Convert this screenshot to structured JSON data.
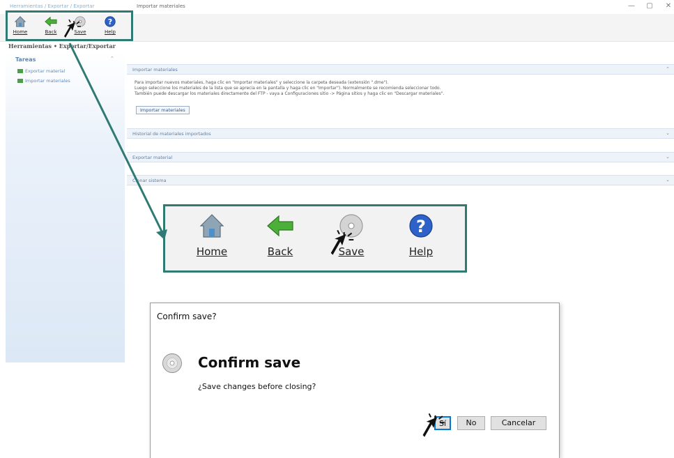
{
  "window": {
    "title_left": "Herramientas / Exportar / Exportar",
    "title": "Importar materiales",
    "minimize": "—",
    "maximize": "▢",
    "close": "✕"
  },
  "toolbar": {
    "home": "Home",
    "back": "Back",
    "save": "Save",
    "help": "Help"
  },
  "breadcrumb": "Herramientas • Exportar/Exportar",
  "sidebar": {
    "title": "Tareas",
    "collapse": "⌃",
    "tasks": [
      "Exportar material",
      "Importar materiales"
    ]
  },
  "panels": {
    "import_title": "Importar materiales",
    "import_lines": [
      "Para importar nuevos materiales, haga clic en \"Importar materiales\" y seleccione la carpeta deseada (extensión \".dme\").",
      "Luego seleccione los materiales de la lista que se aprecia en la pantalla y haga clic en \"Importar\"). Normalmente se recomienda seleccionar todo.",
      "También puede descargar los materiales directamente del FTP - vaya a Configuraciones sitio -> Página sitios y haga clic en \"Descargar materiales\"."
    ],
    "import_button": "Importar materiales",
    "history_title": "Historial de materiales importados",
    "export_title": "Exportar material",
    "clone_title": "Clonar sistema",
    "arrow_up": "⌃",
    "arrow_down": "⌄"
  },
  "zoom": {
    "home": "Home",
    "back": "Back",
    "save": "Save",
    "help": "Help"
  },
  "dialog": {
    "title": "Confirm save?",
    "heading": "Confirm save",
    "message": "¿Save changes before closing?",
    "yes": "Sí",
    "no": "No",
    "cancel": "Cancelar"
  },
  "colors": {
    "highlight": "#2f7a73",
    "link": "#5d8ac0",
    "dialog_focus": "#0078d7"
  }
}
